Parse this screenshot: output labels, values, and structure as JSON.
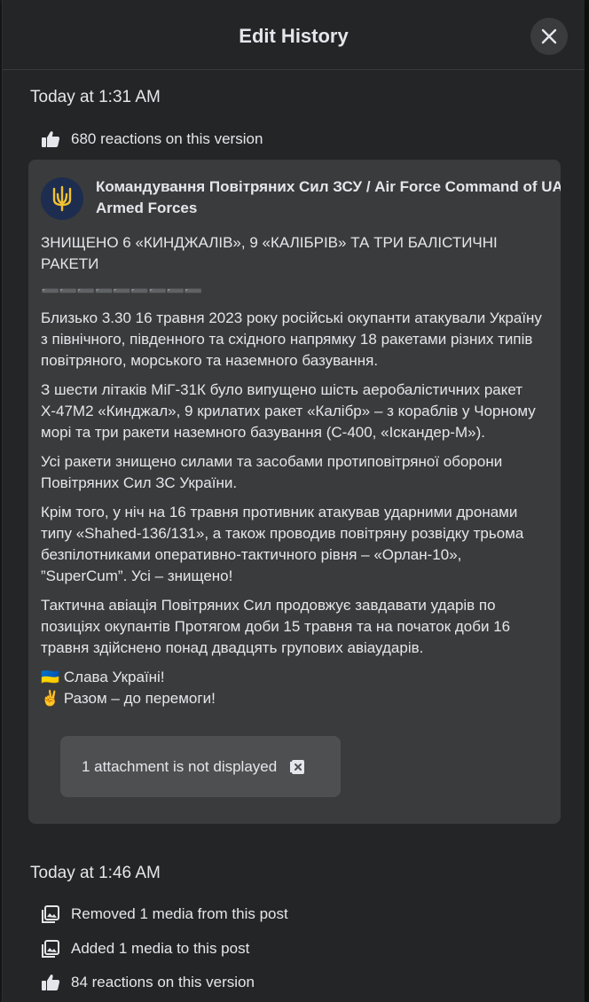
{
  "modal": {
    "title": "Edit History"
  },
  "versions": [
    {
      "time": "Today at 1:31 AM",
      "reactions": "680 reactions on this version",
      "post": {
        "author": "Командування Повітряних Сил ЗСУ / Air Force Command of UA Armed Forces",
        "headline": "ЗНИЩЕНО 6 «КИНДЖАЛІВ», 9 «КАЛІБРІВ» ТА ТРИ БАЛІСТИЧНІ РАКЕТИ",
        "divider": "➖➖➖➖➖➖➖➖➖",
        "paragraphs": [
          "Близько 3.30 16 травня 2023 року російські окупанти атакували Україну з північного, південного та східного напрямку 18 ракетами різних типів повітряного, морського та наземного базування.",
          "З шести літаків МіГ-31К було випущено шість аеробалістичних ракет Х-47М2 «Кинджал», 9 крилатих ракет «Калібр» – з кораблів у Чорному морі та три ракети наземного базування (С-400, «Іскандер-М»).",
          "Усі ракети знищено силами та засобами протиповітряної оборони Повітряних Сил ЗС України.",
          "Крім того, у ніч на 16 травня противник атакував ударними дронами типу «Shahed-136/131», а також проводив повітряну розвідку трьома безпілотниками оперативно-тактичного рівня – «Орлан-10», ”SuperCum”. Усі – знищено!",
          "Тактична авіація Повітряних Сил продовжує завдавати ударів по позиціях окупантів Протягом доби 15 травня та на початок доби 16 травня здійснено понад двадцять групових авіаударів."
        ],
        "closing_1": "🇺🇦 Слава Україні!",
        "closing_2": "✌️ Разом – до перемоги!",
        "attachment": "1 attachment is not displayed"
      }
    },
    {
      "time": "Today at 1:46 AM",
      "changes": [
        "Removed 1 media from this post",
        "Added 1 media to this post"
      ],
      "reactions": "84 reactions on this version"
    }
  ],
  "icons": {
    "close": "close-icon",
    "reactions": "thumbs-up-icon",
    "media": "photo-icon",
    "attachment": "attachment-hidden-icon"
  },
  "colors": {
    "modal_bg": "#242526",
    "card_bg": "#3a3b3c",
    "text": "#e4e6eb",
    "attachment_bg": "#4e4f50"
  }
}
